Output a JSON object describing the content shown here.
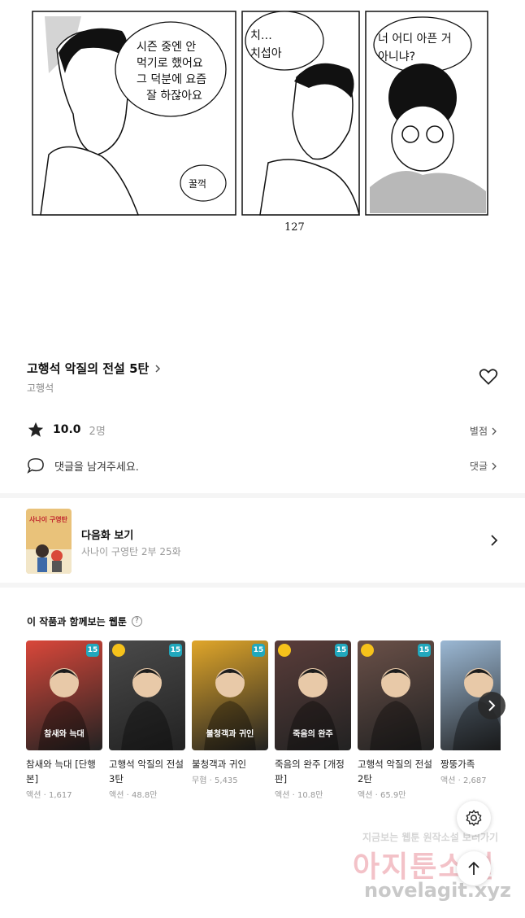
{
  "comic": {
    "bubble1": [
      "시즌 중엔 안",
      "먹기로 했어요",
      "그 덕분에 요즘",
      "잘 하잖아요"
    ],
    "bubble2": [
      "치…",
      "치섭아"
    ],
    "bubble3": [
      "너 어디 아픈 거",
      "아니냐?"
    ],
    "sfx": "꿀꺽",
    "page_number": "127"
  },
  "episode": {
    "title": "고행석 악질의 전설 5탄",
    "author": "고행석",
    "rating": "10.0",
    "rating_count": "2명",
    "rating_link": "별점",
    "comment_placeholder": "댓글을 남겨주세요.",
    "comment_link": "댓글"
  },
  "next": {
    "label": "다음화 보기",
    "sub": "사나이 구영탄 2부 25화",
    "thumb_text": "사나이 구영탄"
  },
  "recommend": {
    "heading": "이 작품과 함께보는 웹툰",
    "help": "?",
    "items": [
      {
        "name": "참새와 늑대 [단행본]",
        "genre": "액션",
        "count": "1,617",
        "badge": "15",
        "clock": false,
        "color": "#d9473a",
        "thumb_text": "참새와 늑대"
      },
      {
        "name": "고행석 악질의 전설 3탄",
        "genre": "액션",
        "count": "48.8만",
        "badge": "15",
        "clock": true,
        "color": "#4a4a4a",
        "thumb_text": ""
      },
      {
        "name": "불청객과 귀인",
        "genre": "무협",
        "count": "5,435",
        "badge": "15",
        "clock": false,
        "color": "#e0a62a",
        "thumb_text": "불청객과 귀인"
      },
      {
        "name": "죽음의 완주 [개정판]",
        "genre": "액션",
        "count": "10.8만",
        "badge": "15",
        "clock": true,
        "color": "#5a3d3a",
        "thumb_text": "죽음의 완주"
      },
      {
        "name": "고행석 악질의 전설 2탄",
        "genre": "액션",
        "count": "65.9만",
        "badge": "15",
        "clock": true,
        "color": "#6a5048",
        "thumb_text": ""
      },
      {
        "name": "짱뚱가족",
        "genre": "액션",
        "count": "2,687",
        "badge": "",
        "clock": false,
        "color": "#9bb8d4",
        "thumb_text": ""
      }
    ]
  },
  "watermark": {
    "line1": "지금보는 웹툰 원작소설 보러가기",
    "line2": "아지툰소설",
    "line3": "novelagit.xyz"
  }
}
